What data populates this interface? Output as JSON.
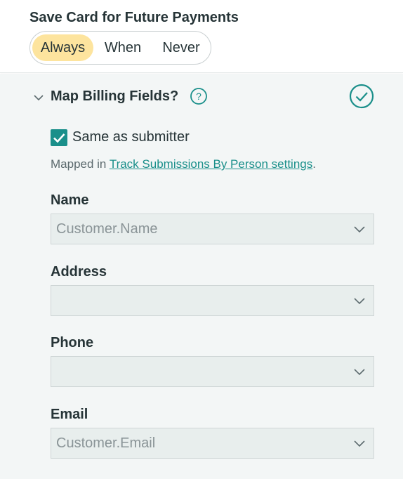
{
  "save_card": {
    "title": "Save Card for Future Payments",
    "options": [
      "Always",
      "When",
      "Never"
    ],
    "selected": "Always",
    "selected_color": "#fde49e"
  },
  "billing": {
    "title": "Map Billing Fields?",
    "help_icon": "question-circle-icon",
    "status_icon": "check-circle-icon",
    "accent_color": "#1a8f8a",
    "same_as_submitter": {
      "label": "Same as submitter",
      "checked": true
    },
    "mapped_prefix": "Mapped in ",
    "mapped_link": "Track Submissions By Person settings",
    "mapped_suffix": ".",
    "fields": [
      {
        "label": "Name",
        "value": "Customer.Name"
      },
      {
        "label": "Address",
        "value": ""
      },
      {
        "label": "Phone",
        "value": ""
      },
      {
        "label": "Email",
        "value": "Customer.Email"
      }
    ]
  }
}
